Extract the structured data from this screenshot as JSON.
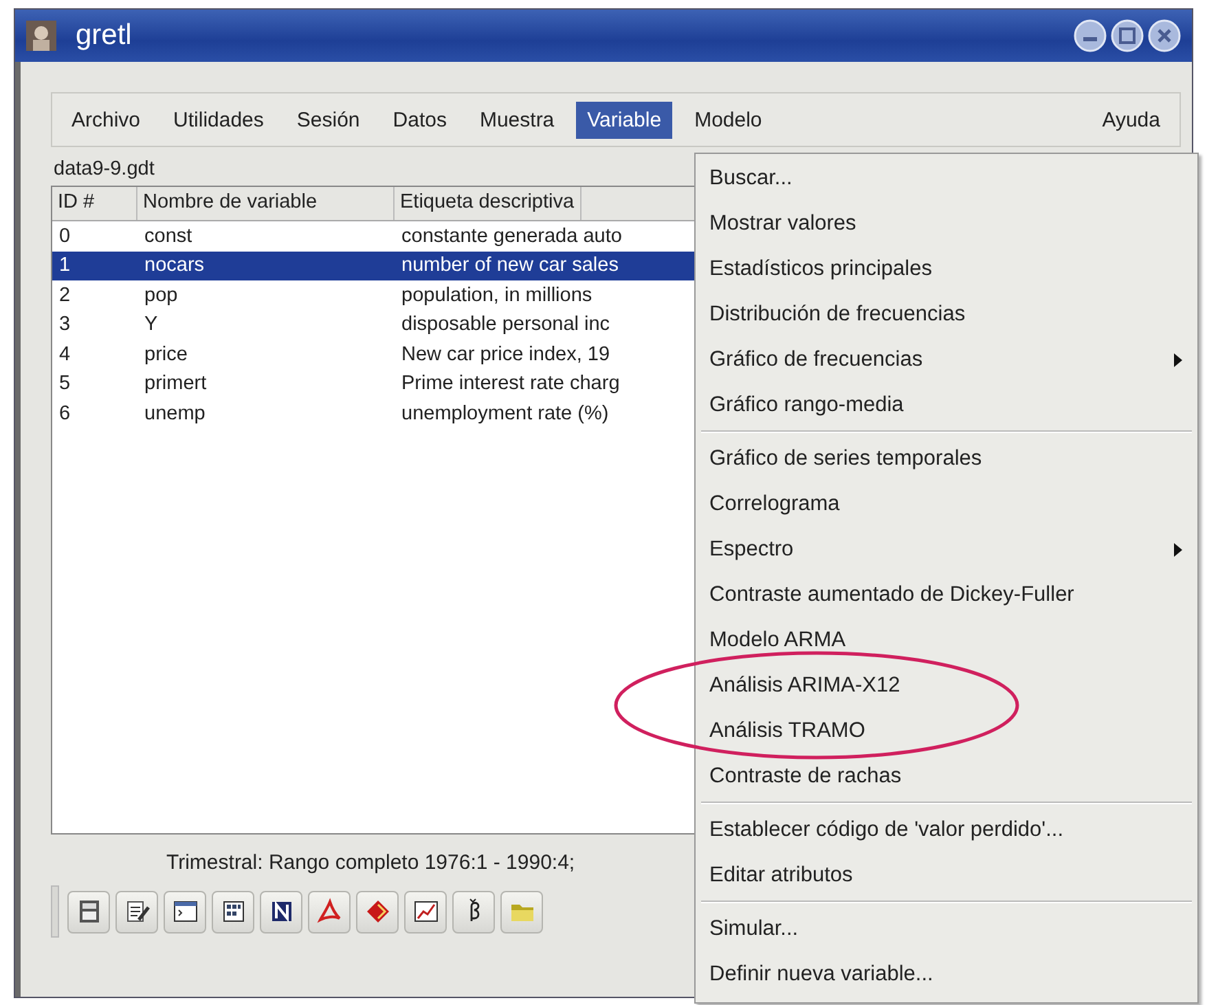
{
  "window": {
    "title": "gretl"
  },
  "menubar": [
    {
      "label": "Archivo",
      "selected": false
    },
    {
      "label": "Utilidades",
      "selected": false
    },
    {
      "label": "Sesión",
      "selected": false
    },
    {
      "label": "Datos",
      "selected": false
    },
    {
      "label": "Muestra",
      "selected": false
    },
    {
      "label": "Variable",
      "selected": true
    },
    {
      "label": "Modelo",
      "selected": false
    },
    {
      "label": "Ayuda",
      "selected": false
    }
  ],
  "filename": "data9-9.gdt",
  "table": {
    "columns": [
      "ID #",
      "Nombre de variable",
      "Etiqueta descriptiva"
    ],
    "rows": [
      {
        "cells": [
          "0",
          "const",
          "constante generada auto"
        ],
        "selected": false
      },
      {
        "cells": [
          "1",
          "nocars",
          "number of new car sales"
        ],
        "selected": true
      },
      {
        "cells": [
          "2",
          "pop",
          "population, in millions"
        ],
        "selected": false
      },
      {
        "cells": [
          "3",
          "Y",
          "disposable personal inc"
        ],
        "selected": false
      },
      {
        "cells": [
          "4",
          "price",
          "New car price index, 19"
        ],
        "selected": false
      },
      {
        "cells": [
          "5",
          "primert",
          "Prime interest rate charg"
        ],
        "selected": false
      },
      {
        "cells": [
          "6",
          "unemp",
          "unemployment rate (%)"
        ],
        "selected": false
      }
    ]
  },
  "status_bar": "Trimestral: Rango completo 1976:1 - 1990:4;",
  "variable_menu": [
    {
      "kind": "item",
      "label": "Buscar...",
      "submenu": false,
      "circled": false
    },
    {
      "kind": "item",
      "label": "Mostrar valores",
      "submenu": false,
      "circled": false
    },
    {
      "kind": "item",
      "label": "Estadísticos principales",
      "submenu": false,
      "circled": false
    },
    {
      "kind": "item",
      "label": "Distribución de frecuencias",
      "submenu": false,
      "circled": false
    },
    {
      "kind": "item",
      "label": "Gráfico de frecuencias",
      "submenu": true,
      "circled": false
    },
    {
      "kind": "item",
      "label": "Gráfico rango-media",
      "submenu": false,
      "circled": false
    },
    {
      "kind": "separator"
    },
    {
      "kind": "item",
      "label": "Gráfico de series temporales",
      "submenu": false,
      "circled": false
    },
    {
      "kind": "item",
      "label": "Correlograma",
      "submenu": false,
      "circled": false
    },
    {
      "kind": "item",
      "label": "Espectro",
      "submenu": true,
      "circled": false
    },
    {
      "kind": "item",
      "label": "Contraste aumentado de Dickey-Fuller",
      "submenu": false,
      "circled": false
    },
    {
      "kind": "item",
      "label": "Modelo ARMA",
      "submenu": false,
      "circled": false
    },
    {
      "kind": "item",
      "label": "Análisis ARIMA-X12",
      "submenu": false,
      "circled": true
    },
    {
      "kind": "item",
      "label": "Análisis TRAMO",
      "submenu": false,
      "circled": true
    },
    {
      "kind": "item",
      "label": "Contraste de rachas",
      "submenu": false,
      "circled": false
    },
    {
      "kind": "separator"
    },
    {
      "kind": "item",
      "label": "Establecer código de 'valor perdido'...",
      "submenu": false,
      "circled": false
    },
    {
      "kind": "item",
      "label": "Editar atributos",
      "submenu": false,
      "circled": false
    },
    {
      "kind": "separator"
    },
    {
      "kind": "item",
      "label": "Simular...",
      "submenu": false,
      "circled": false
    },
    {
      "kind": "item",
      "label": "Definir nueva variable...",
      "submenu": false,
      "circled": false
    }
  ]
}
